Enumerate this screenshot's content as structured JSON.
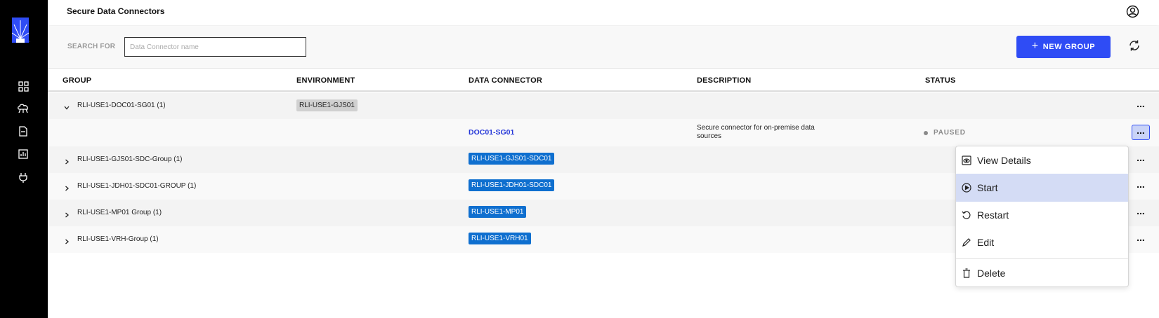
{
  "app": {
    "title": "Secure Data Connectors"
  },
  "sidebar": {
    "items": [
      {
        "icon": "dashboard-icon"
      },
      {
        "icon": "cloud-network-icon"
      },
      {
        "icon": "document-icon"
      },
      {
        "icon": "report-chart-icon"
      },
      {
        "icon": "plug-icon"
      }
    ]
  },
  "toolbar": {
    "search_label": "SEARCH FOR",
    "search_placeholder": "Data Connector name",
    "search_value": "",
    "new_group_label": "NEW GROUP"
  },
  "table": {
    "columns": [
      "GROUP",
      "ENVIRONMENT",
      "DATA CONNECTOR",
      "DESCRIPTION",
      "STATUS"
    ],
    "rows": [
      {
        "group": "RLI-USE1-DOC01-SG01 (1)",
        "environment": "RLI-USE1-GJS01",
        "expanded": true
      },
      {
        "connector": "DOC01-SG01",
        "description": "Secure connector for on-premise data sources",
        "status": "PAUSED"
      },
      {
        "group": "RLI-USE1-GJS01-SDC-Group (1)",
        "connector": "RLI-USE1-GJS01-SDC01"
      },
      {
        "group": "RLI-USE1-JDH01-SDC01-GROUP (1)",
        "connector": "RLI-USE1-JDH01-SDC01"
      },
      {
        "group": "RLI-USE1-MP01 Group (1)",
        "connector": "RLI-USE1-MP01"
      },
      {
        "group": "RLI-USE1-VRH-Group (1)",
        "connector": "RLI-USE1-VRH01"
      }
    ]
  },
  "context_menu": {
    "items": [
      {
        "label": "View Details",
        "icon": "view-icon"
      },
      {
        "label": "Start",
        "icon": "play-icon",
        "highlighted": true
      },
      {
        "label": "Restart",
        "icon": "restart-icon"
      },
      {
        "label": "Edit",
        "icon": "pencil-icon"
      },
      {
        "label": "Delete",
        "icon": "trash-icon"
      }
    ]
  },
  "colors": {
    "accent": "#2f4cf5",
    "connector_tag": "#0f6fcf",
    "sidebar_bg": "#000000",
    "menu_highlight": "#d4dcf5"
  }
}
